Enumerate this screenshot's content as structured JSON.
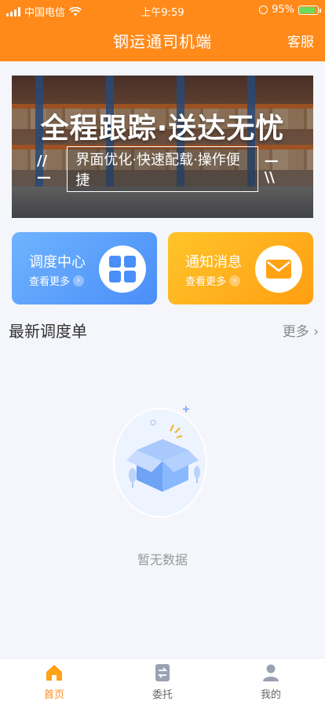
{
  "status_bar": {
    "carrier": "中国电信",
    "time": "上午9:59",
    "battery": "95%"
  },
  "header": {
    "title": "钢运通司机端",
    "right_action": "客服"
  },
  "banner": {
    "headline": "全程跟踪·送达无忧",
    "subline": "界面优化·快速配载·操作便捷",
    "deco_left": "//—",
    "deco_right": "—\\\\"
  },
  "cards": [
    {
      "title": "调度中心",
      "more": "查看更多",
      "icon": "grid-icon",
      "color": "#4a8ef8"
    },
    {
      "title": "通知消息",
      "more": "查看更多",
      "icon": "mail-icon",
      "color": "#ff9e12"
    }
  ],
  "section": {
    "title": "最新调度单",
    "more": "更多"
  },
  "empty": {
    "text": "暂无数据"
  },
  "tabs": [
    {
      "label": "首页",
      "icon": "home-icon",
      "active": true
    },
    {
      "label": "委托",
      "icon": "transfer-icon",
      "active": false
    },
    {
      "label": "我的",
      "icon": "person-icon",
      "active": false
    }
  ],
  "colors": {
    "accent": "#ff8a1a",
    "background": "#f4f6fb"
  }
}
